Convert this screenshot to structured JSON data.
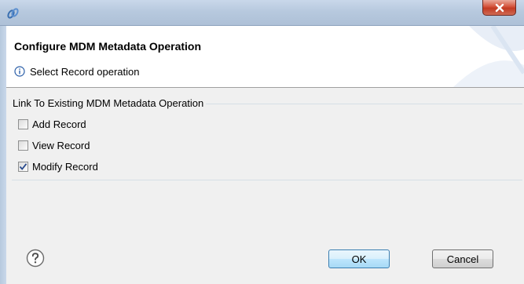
{
  "dialog": {
    "title": "Configure MDM Metadata Operation",
    "message": "Select Record operation",
    "message_icon": "info-icon"
  },
  "group": {
    "label": "Link To Existing MDM Metadata Operation",
    "options": [
      {
        "label": "Add Record",
        "checked": false
      },
      {
        "label": "View Record",
        "checked": false
      },
      {
        "label": "Modify Record",
        "checked": true
      }
    ]
  },
  "buttons": {
    "ok_label": "OK",
    "cancel_label": "Cancel"
  },
  "icons": {
    "app": "app-icon",
    "close": "close-icon",
    "help": "help-icon"
  },
  "colors": {
    "titlebar": "#b7c9de",
    "close_button": "#c23a22",
    "ok_border": "#3c7fb1"
  }
}
